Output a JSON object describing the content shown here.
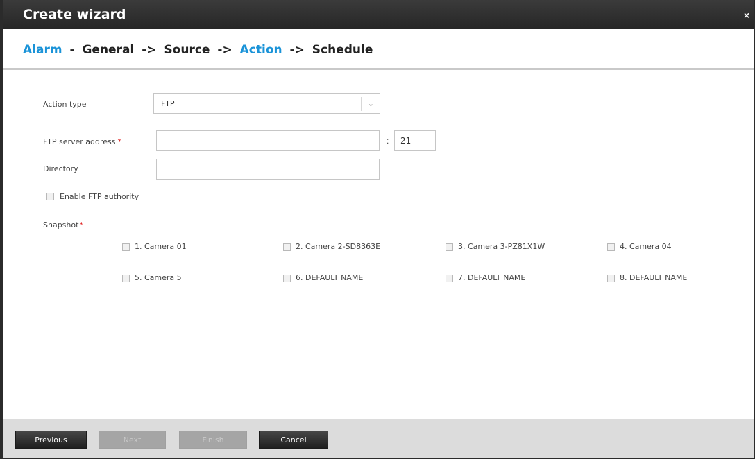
{
  "window": {
    "title": "Create wizard",
    "close_label": "×"
  },
  "breadcrumb": {
    "alarm": "Alarm",
    "sep1": "-",
    "general": "General",
    "sep2": "->",
    "source": "Source",
    "sep3": "->",
    "action": "Action",
    "sep4": "->",
    "schedule": "Schedule",
    "highlight_color": "#1a93d8"
  },
  "form": {
    "action_type_label": "Action type",
    "action_type_value": "FTP",
    "ftp_server_label": "FTP server address",
    "ftp_server_value": "",
    "port_separator": ":",
    "port_value": "21",
    "directory_label": "Directory",
    "directory_value": "",
    "enable_ftp_auth_label": "Enable FTP authority",
    "snapshot_label": "Snapshot",
    "required_marker": "*"
  },
  "cameras": [
    "1. Camera 01",
    "2. Camera 2-SD8363E",
    "3. Camera 3-PZ81X1W",
    "4. Camera 04",
    "5. Camera 5",
    "6. DEFAULT NAME",
    "7. DEFAULT NAME",
    "8. DEFAULT NAME"
  ],
  "footer": {
    "previous": "Previous",
    "next": "Next",
    "finish": "Finish",
    "cancel": "Cancel"
  }
}
